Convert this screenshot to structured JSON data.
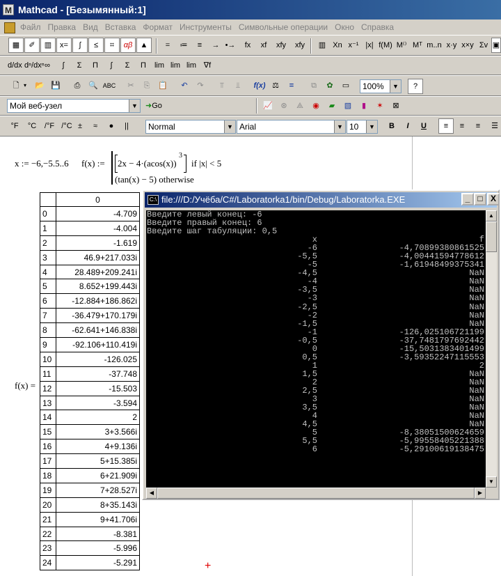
{
  "app": {
    "title": "Mathcad - [Безымянный:1]",
    "logo_letter": "M"
  },
  "menu": [
    "Файл",
    "Правка",
    "Вид",
    "Вставка",
    "Формат",
    "Инструменты",
    "Символьные операции",
    "Окно",
    "Справка"
  ],
  "toolbar_math": {
    "items": [
      "=",
      "≔",
      "≡",
      "→",
      "•→",
      "fx",
      "xf",
      "xfy",
      "xfy"
    ],
    "extra": [
      "Xn",
      "x⁻¹",
      "|x|",
      "f(M)",
      "M⁽⁾",
      "Mᵀ",
      "m..n",
      "x·y",
      "x×y",
      "Σv"
    ]
  },
  "toolbar_calculus": [
    "d/dx",
    "dⁿ/dxⁿ",
    "∞",
    "∫",
    "Σ",
    "Π",
    "∫",
    "Σ",
    "Π",
    "lim",
    "lim",
    "lim",
    "∇f"
  ],
  "toolbar_standard": {
    "zoom": "100%",
    "help": "?"
  },
  "web": {
    "address": "Мой веб-узел",
    "go_label": "Go"
  },
  "format_bar": {
    "units": [
      "°F",
      "°C",
      "/°F",
      "/°C",
      "±",
      "≈",
      "●",
      "||"
    ],
    "style": "Normal",
    "font": "Arial",
    "size": "10",
    "bold": "B",
    "italic": "I",
    "underline": "U"
  },
  "worksheet": {
    "range_def": "x := −6,−5.5..6",
    "func_lhs": "f(x) :=",
    "case1": "2x − 4·(acos(x))",
    "case1_exp": "3",
    "case1_cond": "if  |x| < 5",
    "case2": "(tan(x) − 5)   otherwise",
    "result_label": "f(x) =",
    "table_header": "0",
    "table": [
      [
        "0",
        "-4.709"
      ],
      [
        "1",
        "-4.004"
      ],
      [
        "2",
        "-1.619"
      ],
      [
        "3",
        "46.9+217.033i"
      ],
      [
        "4",
        "28.489+209.241i"
      ],
      [
        "5",
        "8.652+199.443i"
      ],
      [
        "6",
        "-12.884+186.862i"
      ],
      [
        "7",
        "-36.479+170.179i"
      ],
      [
        "8",
        "-62.641+146.838i"
      ],
      [
        "9",
        "-92.106+110.419i"
      ],
      [
        "10",
        "-126.025"
      ],
      [
        "11",
        "-37.748"
      ],
      [
        "12",
        "-15.503"
      ],
      [
        "13",
        "-3.594"
      ],
      [
        "14",
        "2"
      ],
      [
        "15",
        "3+3.566i"
      ],
      [
        "16",
        "4+9.136i"
      ],
      [
        "17",
        "5+15.385i"
      ],
      [
        "18",
        "6+21.909i"
      ],
      [
        "19",
        "7+28.527i"
      ],
      [
        "20",
        "8+35.143i"
      ],
      [
        "21",
        "9+41.706i"
      ],
      [
        "22",
        "-8.381"
      ],
      [
        "23",
        "-5.996"
      ],
      [
        "24",
        "-5.291"
      ]
    ],
    "cursor": "+"
  },
  "console": {
    "title": "file:///D:/Учёба/C#/Laboratorka1/bin/Debug/Laboratorka.EXE",
    "icon_label": "C:\\",
    "buttons": [
      "_",
      "□",
      "X"
    ],
    "prompts": [
      "Введите левый конец: -6",
      "Введите правый конец: 6",
      "Введите шаг табуляции: 0,5"
    ],
    "header": {
      "x": "x",
      "f": "f"
    },
    "rows": [
      [
        "-6",
        "-4,70899380861525"
      ],
      [
        "-5,5",
        "-4,00441594778612"
      ],
      [
        "-5",
        "-1,61948499375341"
      ],
      [
        "-4,5",
        "NaN"
      ],
      [
        "-4",
        "NaN"
      ],
      [
        "-3,5",
        "NaN"
      ],
      [
        "-3",
        "NaN"
      ],
      [
        "-2,5",
        "NaN"
      ],
      [
        "-2",
        "NaN"
      ],
      [
        "-1,5",
        "NaN"
      ],
      [
        "-1",
        "-126,025106721199"
      ],
      [
        "-0,5",
        "-37,7481797692442"
      ],
      [
        "0",
        "-15,5031383401499"
      ],
      [
        "0,5",
        "-3,59352247115553"
      ],
      [
        "1",
        "2"
      ],
      [
        "1,5",
        "NaN"
      ],
      [
        "2",
        "NaN"
      ],
      [
        "2,5",
        "NaN"
      ],
      [
        "3",
        "NaN"
      ],
      [
        "3,5",
        "NaN"
      ],
      [
        "4",
        "NaN"
      ],
      [
        "4,5",
        "NaN"
      ],
      [
        "5",
        "-8,38051500624659"
      ],
      [
        "5,5",
        "-5,99558405221388"
      ],
      [
        "6",
        "-5,29100619138475"
      ]
    ]
  }
}
